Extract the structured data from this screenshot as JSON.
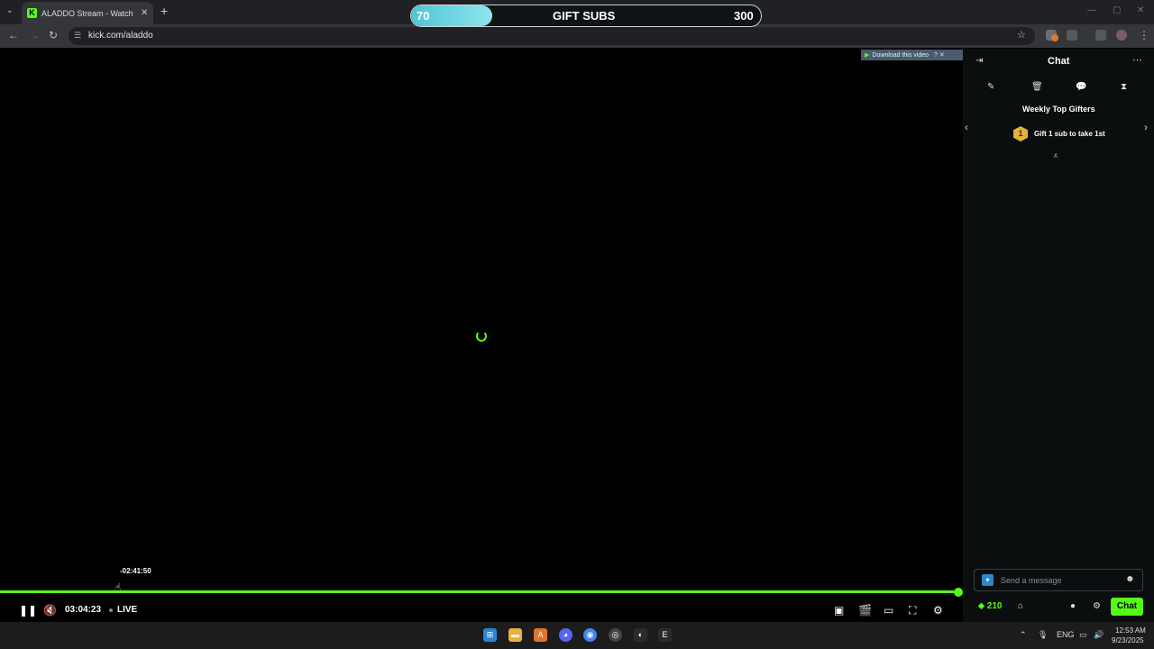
{
  "browser": {
    "tab_title": "ALADDO Stream - Watch Live o",
    "favicon_letter": "K",
    "url": "kick.com/aladdo",
    "icons": [
      "tab-list-icon",
      "close-icon",
      "plus-icon",
      "back-icon",
      "forward-icon",
      "reload-icon",
      "site-info-icon",
      "star-icon"
    ]
  },
  "gift_goal": {
    "current": "70",
    "goal": "300",
    "title": "GIFT SUBS",
    "progress": 0.233
  },
  "download_banner": {
    "label": "Download this video",
    "extra": "? ✕"
  },
  "player": {
    "seek_tooltip": "-02:41:50",
    "elapsed": "03:04:23",
    "live_label": "LIVE",
    "progress": 0.995,
    "accent_color": "#53fc18"
  },
  "chat": {
    "title": "Chat",
    "weekly_title": "Weekly Top Gifters",
    "rank": "1",
    "gift_cta": "Gift 1 sub to take 1st",
    "message_placeholder": "Send a message",
    "points": "210",
    "send_label": "Chat"
  },
  "taskbar": {
    "language": "ENG",
    "time": "12:53 AM",
    "date": "9/23/2025"
  }
}
